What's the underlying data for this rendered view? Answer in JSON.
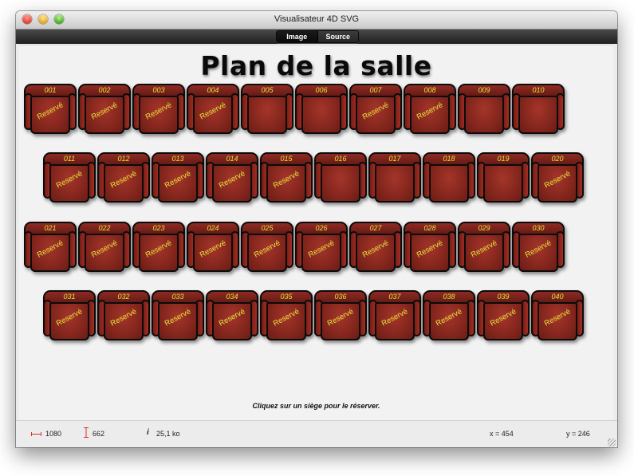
{
  "window": {
    "title": "Visualisateur 4D SVG"
  },
  "toolbar": {
    "tab_image": "Image",
    "tab_source": "Source"
  },
  "page": {
    "title": "Plan de la salle",
    "instruction": "Cliquez sur un siège pour le réserver.",
    "reserved_label": "Reservé"
  },
  "seats": [
    {
      "number": "001",
      "reserved": true
    },
    {
      "number": "002",
      "reserved": true
    },
    {
      "number": "003",
      "reserved": true
    },
    {
      "number": "004",
      "reserved": true
    },
    {
      "number": "005",
      "reserved": false
    },
    {
      "number": "006",
      "reserved": false
    },
    {
      "number": "007",
      "reserved": true
    },
    {
      "number": "008",
      "reserved": true
    },
    {
      "number": "009",
      "reserved": false
    },
    {
      "number": "010",
      "reserved": false
    },
    {
      "number": "011",
      "reserved": true
    },
    {
      "number": "012",
      "reserved": true
    },
    {
      "number": "013",
      "reserved": true
    },
    {
      "number": "014",
      "reserved": true
    },
    {
      "number": "015",
      "reserved": true
    },
    {
      "number": "016",
      "reserved": false
    },
    {
      "number": "017",
      "reserved": false
    },
    {
      "number": "018",
      "reserved": false
    },
    {
      "number": "019",
      "reserved": false
    },
    {
      "number": "020",
      "reserved": true
    },
    {
      "number": "021",
      "reserved": true
    },
    {
      "number": "022",
      "reserved": true
    },
    {
      "number": "023",
      "reserved": true
    },
    {
      "number": "024",
      "reserved": true
    },
    {
      "number": "025",
      "reserved": true
    },
    {
      "number": "026",
      "reserved": true
    },
    {
      "number": "027",
      "reserved": true
    },
    {
      "number": "028",
      "reserved": true
    },
    {
      "number": "029",
      "reserved": true
    },
    {
      "number": "030",
      "reserved": true
    },
    {
      "number": "031",
      "reserved": true
    },
    {
      "number": "032",
      "reserved": true
    },
    {
      "number": "033",
      "reserved": true
    },
    {
      "number": "034",
      "reserved": true
    },
    {
      "number": "035",
      "reserved": true
    },
    {
      "number": "036",
      "reserved": true
    },
    {
      "number": "037",
      "reserved": true
    },
    {
      "number": "038",
      "reserved": true
    },
    {
      "number": "039",
      "reserved": true
    },
    {
      "number": "040",
      "reserved": true
    }
  ],
  "status": {
    "width": "1080",
    "height": "662",
    "size": "25,1 ko",
    "x": "x = 454",
    "y": "y = 246"
  },
  "colors": {
    "seat_red": "#8a271e",
    "label_yellow": "#e8e23a",
    "width_icon": "#d9322a"
  }
}
